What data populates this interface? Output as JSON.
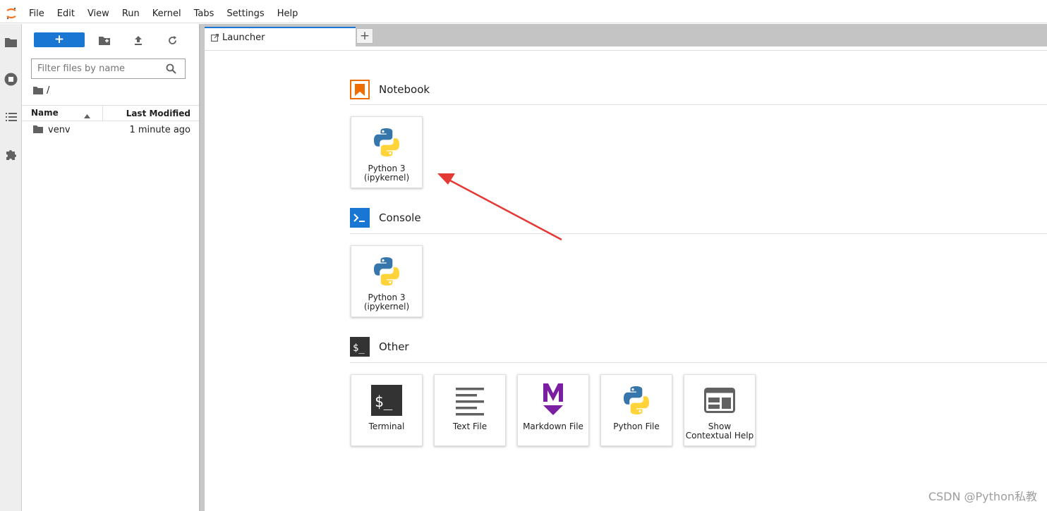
{
  "menubar": {
    "items": [
      "File",
      "Edit",
      "View",
      "Run",
      "Kernel",
      "Tabs",
      "Settings",
      "Help"
    ]
  },
  "activitybar": {
    "icons": [
      "folder-icon",
      "running-icon",
      "toc-icon",
      "extension-icon"
    ]
  },
  "filebrowser": {
    "new_button_label": "+",
    "search_placeholder": "Filter files by name",
    "breadcrumb": "/",
    "columns": {
      "name": "Name",
      "last_modified": "Last Modified"
    },
    "rows": [
      {
        "name": "venv",
        "modified": "1 minute ago"
      }
    ]
  },
  "tabs": {
    "active_label": "Launcher",
    "add_label": "+"
  },
  "launcher": {
    "sections": [
      {
        "title": "Notebook",
        "cards": [
          {
            "label": "Python 3\n(ipykernel)"
          }
        ]
      },
      {
        "title": "Console",
        "cards": [
          {
            "label": "Python 3\n(ipykernel)"
          }
        ]
      },
      {
        "title": "Other",
        "cards": [
          {
            "label": "Terminal"
          },
          {
            "label": "Text File"
          },
          {
            "label": "Markdown File"
          },
          {
            "label": "Python File"
          },
          {
            "label": "Show\nContextual Help"
          }
        ]
      }
    ]
  },
  "watermark": "CSDN @Python私教",
  "colors": {
    "accent": "#1976d2",
    "notebook": "#ef6c00",
    "markdown": "#7b1fa2",
    "arrow": "#e53935"
  }
}
